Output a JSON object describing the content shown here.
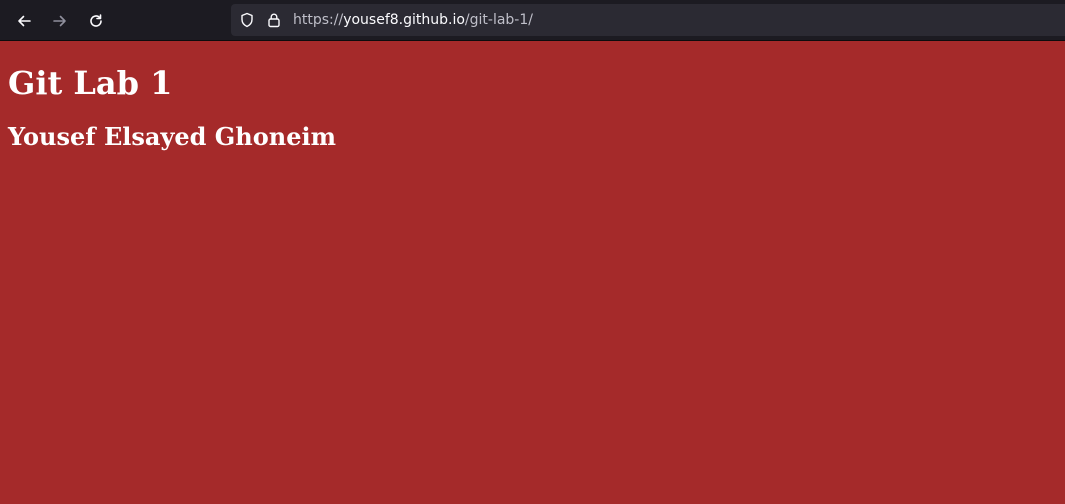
{
  "browser": {
    "url_scheme": "https://",
    "url_host": "yousef8.github.io",
    "url_path": "/git-lab-1/",
    "back_icon": "arrow-left-icon",
    "forward_icon": "arrow-right-icon",
    "reload_icon": "reload-icon",
    "shield_icon": "shield-icon",
    "lock_icon": "lock-icon"
  },
  "page": {
    "title": "Git Lab 1",
    "subtitle": "Yousef Elsayed Ghoneim",
    "background_color": "#a52a2a",
    "text_color": "#ffffff"
  }
}
